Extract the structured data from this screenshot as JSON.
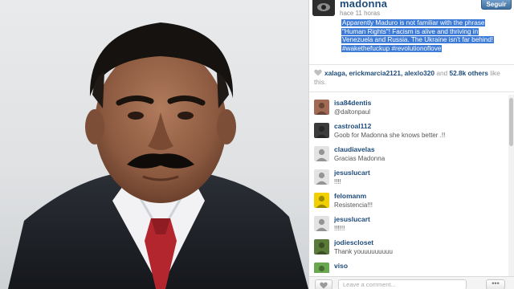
{
  "post": {
    "username": "madonna",
    "follow_label": "Seguir",
    "timestamp": "hace 11 horas",
    "caption_lines": [
      "Apparently Maduro is not familiar with the phrase",
      "\"Human Rights\"! Facism is alive and thriving in",
      "Venezuela and Russia. The Ukraine isn't far behind!",
      "#wakethefuckup #revolutionoflove"
    ]
  },
  "likes": {
    "names": "xalaga, erickmarcia2121, alexlo320",
    "and_text": "and",
    "count": "52.8k others",
    "suffix": "like this."
  },
  "comments": [
    {
      "user": "isa84dentis",
      "text": "@daltonpaul",
      "avatar_color": "#a06a55",
      "avatar_icon": "user-avatar-icon"
    },
    {
      "user": "castroal112",
      "text": "Goob for Madonna she knows better .!!",
      "avatar_color": "#3b3b3b",
      "avatar_icon": "user-avatar-icon"
    },
    {
      "user": "claudiavelas",
      "text": "Gracias Madonna",
      "avatar_color": "#e3e3e3",
      "avatar_icon": "user-avatar-icon"
    },
    {
      "user": "jesuslucart",
      "text": "!!!!",
      "avatar_color": "#e3e3e3",
      "avatar_icon": "user-avatar-icon"
    },
    {
      "user": "felomanm",
      "text": "Resistencia!!!",
      "avatar_color": "#f0d000",
      "avatar_icon": "user-avatar-icon"
    },
    {
      "user": "jesuslucart",
      "text": "!!!!!!",
      "avatar_color": "#e3e3e3",
      "avatar_icon": "user-avatar-icon"
    },
    {
      "user": "jodiescloset",
      "text": "Thank youuuuuuuuu",
      "avatar_color": "#5a7a3a",
      "avatar_icon": "user-avatar-icon"
    },
    {
      "user": "viso",
      "text": "",
      "avatar_color": "#6aa84f",
      "avatar_icon": "user-avatar-icon"
    }
  ],
  "footer": {
    "like_icon": "heart-icon",
    "comment_placeholder": "Leave a comment...",
    "more_icon": "ellipsis-icon"
  },
  "colors": {
    "username": "#1e4b7a",
    "caption_highlight": "#3d7bd9",
    "follow_button": "#3f6f9f"
  }
}
